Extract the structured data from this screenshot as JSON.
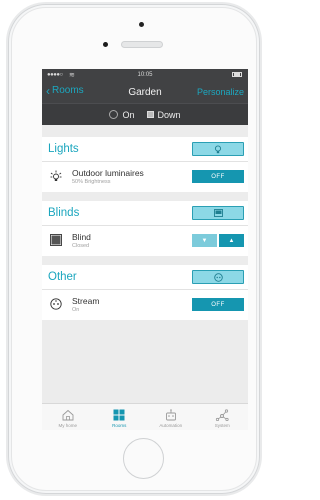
{
  "status_bar": {
    "signal": "●●●●○",
    "time": "10:05"
  },
  "nav": {
    "back_label": "Rooms",
    "title": "Garden",
    "right_label": "Personalize"
  },
  "summary": {
    "lights_state": "On",
    "blinds_state": "Down"
  },
  "sections": [
    {
      "title": "Lights",
      "device": {
        "name": "Outdoor luminaires",
        "status": "50% Brightness",
        "action": "OFF"
      }
    },
    {
      "title": "Blinds",
      "device": {
        "name": "Blind",
        "status": "Closed"
      }
    },
    {
      "title": "Other",
      "device": {
        "name": "Stream",
        "status": "On",
        "action": "OFF"
      }
    }
  ],
  "tabs": [
    {
      "label": "My home",
      "icon": "house-icon"
    },
    {
      "label": "Rooms",
      "icon": "rooms-grid-icon",
      "active": true
    },
    {
      "label": "Automation",
      "icon": "robot-icon"
    },
    {
      "label": "System",
      "icon": "network-icon"
    }
  ],
  "colors": {
    "accent": "#1596b0",
    "accent_light": "#8cd8e6",
    "header_bg": "#414244"
  }
}
